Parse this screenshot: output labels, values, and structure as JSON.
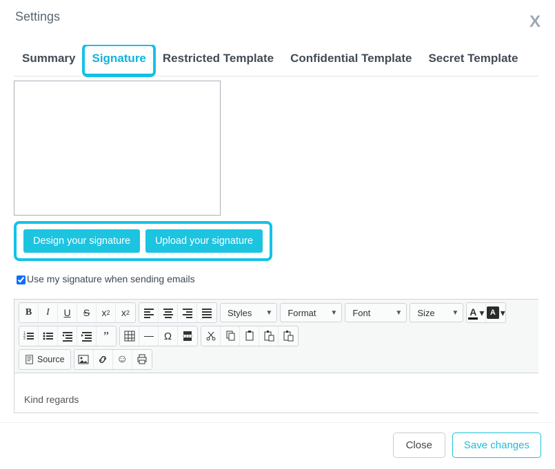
{
  "modal": {
    "title": "Settings",
    "close_glyph": "X"
  },
  "tabs": [
    {
      "label": "Summary"
    },
    {
      "label": "Signature"
    },
    {
      "label": "Restricted Template"
    },
    {
      "label": "Confidential Template"
    },
    {
      "label": "Secret Template"
    }
  ],
  "signature": {
    "design_btn": "Design your signature",
    "upload_btn": "Upload your signature",
    "checkbox_label": "Use my signature when sending emails",
    "checkbox_checked": true
  },
  "toolbar": {
    "bold": "B",
    "italic": "I",
    "underline": "U",
    "strike": "S",
    "sub": "x",
    "sub2": "2",
    "sup": "x",
    "sup2": "2",
    "styles": "Styles",
    "format": "Format",
    "font": "Font",
    "size": "Size",
    "textcolor": "A",
    "bgcolor": "A",
    "omega": "Ω",
    "quote": "”",
    "source": "Source",
    "emoji": "☺"
  },
  "editor": {
    "body_text": "Kind regards"
  },
  "footer": {
    "close": "Close",
    "save": "Save changes"
  }
}
